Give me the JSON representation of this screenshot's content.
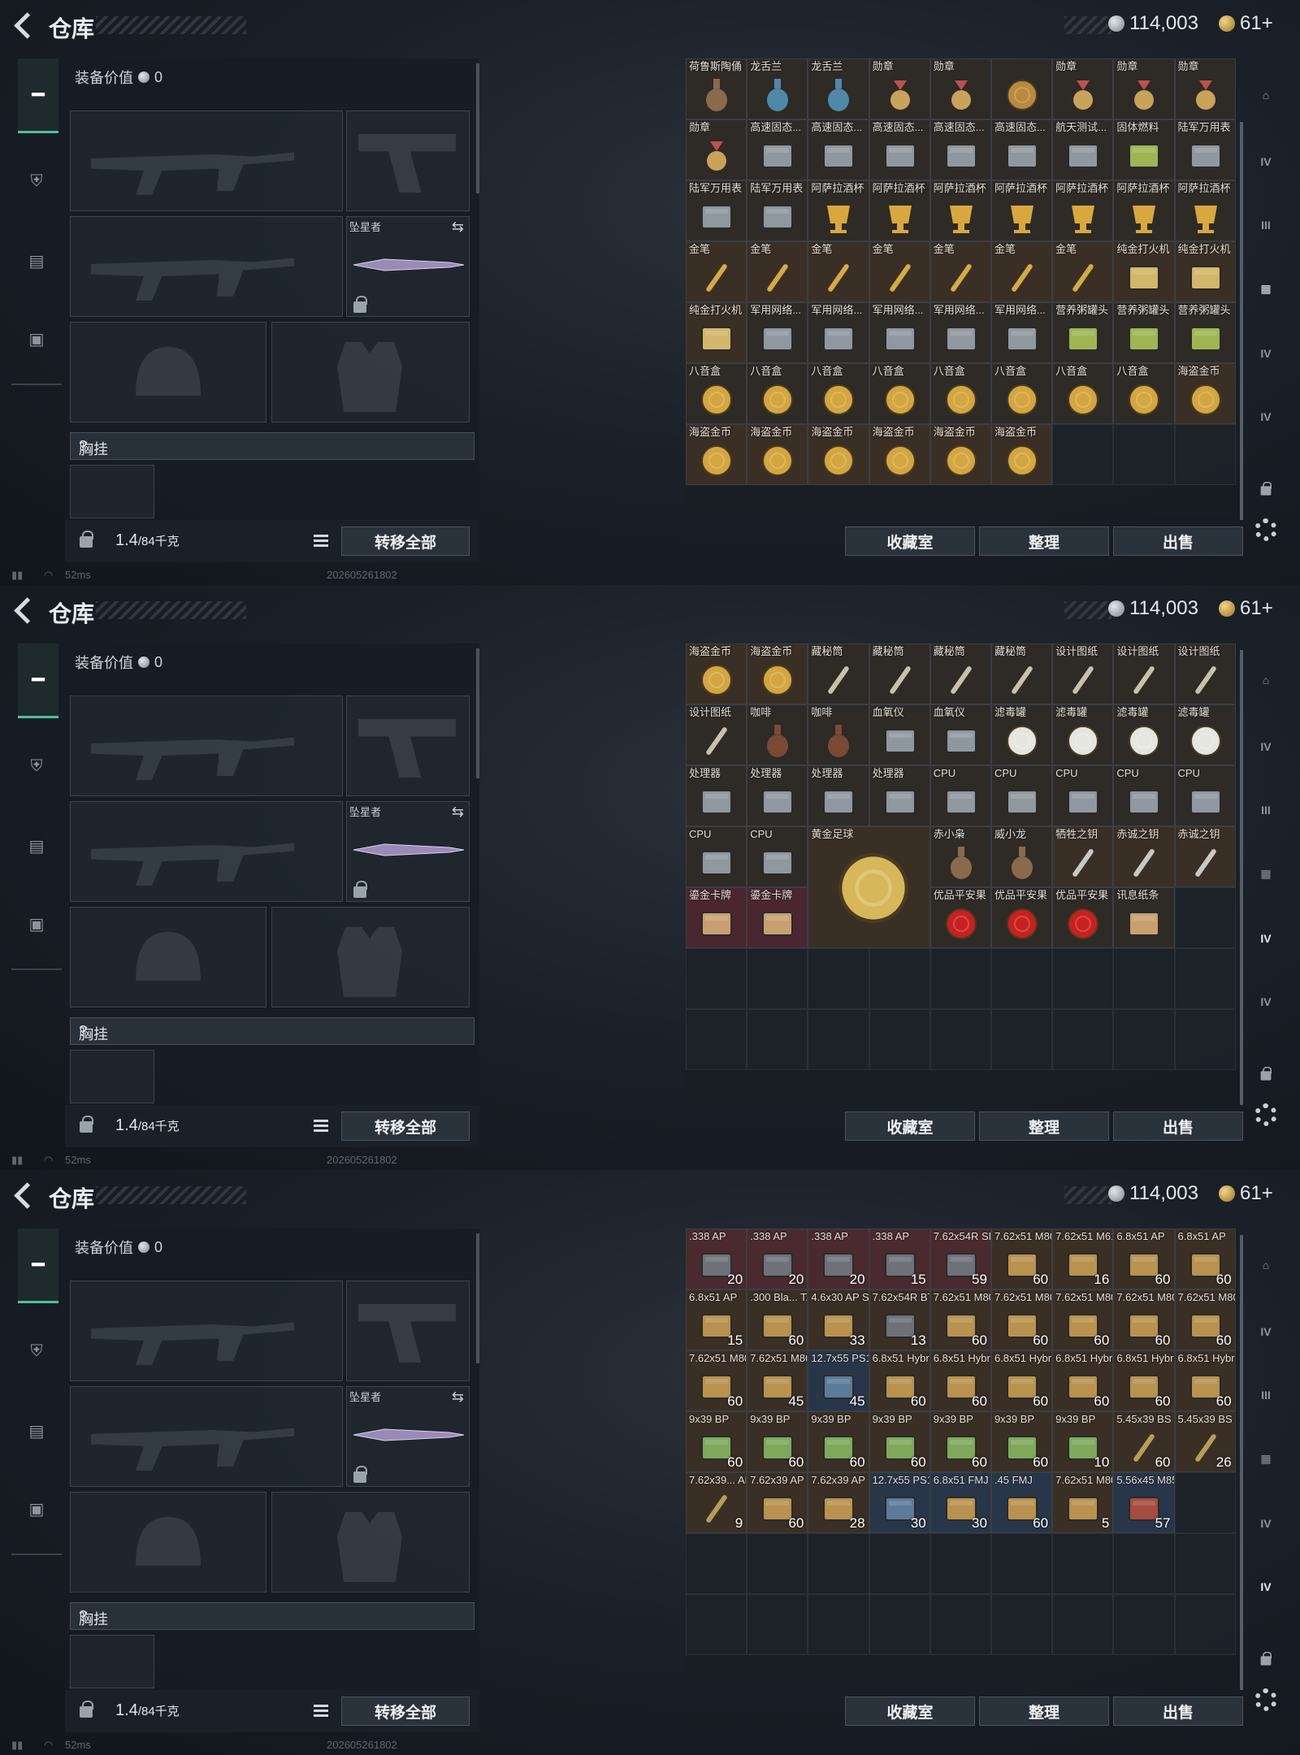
{
  "header": {
    "title": "仓库",
    "silver": "114,003",
    "gold": "61+"
  },
  "left": {
    "equip_value_label": "装备价值",
    "equip_value": "0",
    "melee_name": "坠星者",
    "chest_label": "胸挂",
    "chest_help": "?",
    "weight": "1.4",
    "weight_unit": "/84千克",
    "transfer_all": "转移全部"
  },
  "status": {
    "ping": "52ms",
    "build": "202605261802"
  },
  "buttons": {
    "collection": "收藏室",
    "sort": "整理",
    "sell": "出售"
  },
  "right_bar": {
    "tier_icons": [
      "IV",
      "III",
      "IV",
      "IV"
    ]
  },
  "panels": [
    {
      "items": [
        {
          "n": "荷鲁斯陶俑"
        },
        {
          "n": "龙舌兰"
        },
        {
          "n": "龙舌兰"
        },
        {
          "n": "勋章"
        },
        {
          "n": "勋章"
        },
        {
          "n": ""
        },
        {
          "n": "勋章"
        },
        {
          "n": "勋章"
        },
        {
          "n": "勋章"
        },
        {
          "n": "勋章"
        },
        {
          "n": "高速固态..."
        },
        {
          "n": "高速固态..."
        },
        {
          "n": "高速固态..."
        },
        {
          "n": "高速固态..."
        },
        {
          "n": "高速固态..."
        },
        {
          "n": "航天测试..."
        },
        {
          "n": "固体燃料"
        },
        {
          "n": "陆军万用表"
        },
        {
          "n": "陆军万用表"
        },
        {
          "n": "陆军万用表"
        },
        {
          "n": "阿萨拉酒杯"
        },
        {
          "n": "阿萨拉酒杯"
        },
        {
          "n": "阿萨拉酒杯"
        },
        {
          "n": "阿萨拉酒杯"
        },
        {
          "n": "阿萨拉酒杯"
        },
        {
          "n": "阿萨拉酒杯"
        },
        {
          "n": "阿萨拉酒杯"
        },
        {
          "n": "金笔"
        },
        {
          "n": "金笔"
        },
        {
          "n": "金笔"
        },
        {
          "n": "金笔"
        },
        {
          "n": "金笔"
        },
        {
          "n": "金笔"
        },
        {
          "n": "金笔"
        },
        {
          "n": "纯金打火机"
        },
        {
          "n": "纯金打火机"
        },
        {
          "n": "纯金打火机"
        },
        {
          "n": "军用网络..."
        },
        {
          "n": "军用网络..."
        },
        {
          "n": "军用网络..."
        },
        {
          "n": "军用网络..."
        },
        {
          "n": "军用网络..."
        },
        {
          "n": "营养粥罐头"
        },
        {
          "n": "营养粥罐头"
        },
        {
          "n": "营养粥罐头"
        },
        {
          "n": "八音盒"
        },
        {
          "n": "八音盒"
        },
        {
          "n": "八音盒"
        },
        {
          "n": "八音盒"
        },
        {
          "n": "八音盒"
        },
        {
          "n": "八音盒"
        },
        {
          "n": "八音盒"
        },
        {
          "n": "八音盒"
        },
        {
          "n": "海盗金币"
        },
        {
          "n": "海盗金币"
        },
        {
          "n": "海盗金币"
        },
        {
          "n": "海盗金币"
        },
        {
          "n": "海盗金币"
        },
        {
          "n": "海盗金币"
        },
        {
          "n": "海盗金币"
        }
      ]
    },
    {
      "items": [
        {
          "n": "海盗金币"
        },
        {
          "n": "海盗金币"
        },
        {
          "n": "藏秘筒"
        },
        {
          "n": "藏秘筒"
        },
        {
          "n": "藏秘筒"
        },
        {
          "n": "藏秘筒"
        },
        {
          "n": "设计图纸"
        },
        {
          "n": "设计图纸"
        },
        {
          "n": "设计图纸"
        },
        {
          "n": "设计图纸"
        },
        {
          "n": "咖啡"
        },
        {
          "n": "咖啡"
        },
        {
          "n": "血氧仪"
        },
        {
          "n": "血氧仪"
        },
        {
          "n": "滤毒罐"
        },
        {
          "n": "滤毒罐"
        },
        {
          "n": "滤毒罐"
        },
        {
          "n": "滤毒罐"
        },
        {
          "n": "处理器"
        },
        {
          "n": "处理器"
        },
        {
          "n": "处理器"
        },
        {
          "n": "处理器"
        },
        {
          "n": "CPU"
        },
        {
          "n": "CPU"
        },
        {
          "n": "CPU"
        },
        {
          "n": "CPU"
        },
        {
          "n": "CPU"
        },
        {
          "n": "CPU"
        },
        {
          "n": "CPU"
        },
        {
          "n": "黄金足球",
          "big": true
        },
        {
          "n": "赤小枭"
        },
        {
          "n": "威小龙"
        },
        {
          "n": "牺牲之钥"
        },
        {
          "n": "赤诚之钥"
        },
        {
          "n": "赤诚之钥"
        },
        {
          "n": "鎏金卡牌"
        },
        {
          "n": "鎏金卡牌"
        },
        {
          "n": "优品平安果"
        },
        {
          "n": "优品平安果"
        },
        {
          "n": "优品平安果"
        },
        {
          "n": "讯息纸条"
        }
      ]
    },
    {
      "items": [
        {
          "n": ".338 AP",
          "c": "20"
        },
        {
          "n": ".338 AP",
          "c": "20"
        },
        {
          "n": ".338 AP",
          "c": "20"
        },
        {
          "n": ".338 AP",
          "c": "15"
        },
        {
          "n": "7.62x54R SNB",
          "c": "59"
        },
        {
          "n": "7.62x51 M80",
          "c": "60"
        },
        {
          "n": "7.62x51 M61",
          "c": "16"
        },
        {
          "n": "6.8x51 AP",
          "c": "60"
        },
        {
          "n": "6.8x51 AP",
          "c": "60"
        },
        {
          "n": "6.8x51 AP",
          "c": "15"
        },
        {
          "n": ".300 Bla... TAC-TX",
          "c": "60"
        },
        {
          "n": "4.6x30 AP SX",
          "c": "33"
        },
        {
          "n": "7.62x54R BT",
          "c": "13"
        },
        {
          "n": "7.62x51 M80",
          "c": "60"
        },
        {
          "n": "7.62x51 M80",
          "c": "60"
        },
        {
          "n": "7.62x51 M80",
          "c": "60"
        },
        {
          "n": "7.62x51 M80",
          "c": "60"
        },
        {
          "n": "7.62x51 M80",
          "c": "60"
        },
        {
          "n": "7.62x51 M80",
          "c": "60"
        },
        {
          "n": "7.62x51 M80",
          "c": "45"
        },
        {
          "n": "12.7x55 PS12B",
          "c": "45"
        },
        {
          "n": "6.8x51 Hybrid",
          "c": "60"
        },
        {
          "n": "6.8x51 Hybrid",
          "c": "60"
        },
        {
          "n": "6.8x51 Hybrid",
          "c": "60"
        },
        {
          "n": "6.8x51 Hybrid",
          "c": "60"
        },
        {
          "n": "6.8x51 Hybrid",
          "c": "60"
        },
        {
          "n": "6.8x51 Hybrid",
          "c": "60"
        },
        {
          "n": "9x39 BP",
          "c": "60"
        },
        {
          "n": "9x39 BP",
          "c": "60"
        },
        {
          "n": "9x39 BP",
          "c": "60"
        },
        {
          "n": "9x39 BP",
          "c": "60"
        },
        {
          "n": "9x39 BP",
          "c": "60"
        },
        {
          "n": "9x39 BP",
          "c": "60"
        },
        {
          "n": "9x39 BP",
          "c": "10"
        },
        {
          "n": "5.45x39 BS",
          "c": "60"
        },
        {
          "n": "5.45x39 BS",
          "c": "26"
        },
        {
          "n": "7.62x39... AP SUB",
          "c": "9"
        },
        {
          "n": "7.62x39 AP",
          "c": "60"
        },
        {
          "n": "7.62x39 AP",
          "c": "28"
        },
        {
          "n": "12.7x55 PS12",
          "c": "30"
        },
        {
          "n": "6.8x51 FMJ",
          "c": "30"
        },
        {
          "n": ".45 FMJ",
          "c": "60"
        },
        {
          "n": "7.62x51 M80",
          "c": "5"
        },
        {
          "n": "5.56x45 M855",
          "c": "57"
        }
      ]
    }
  ]
}
